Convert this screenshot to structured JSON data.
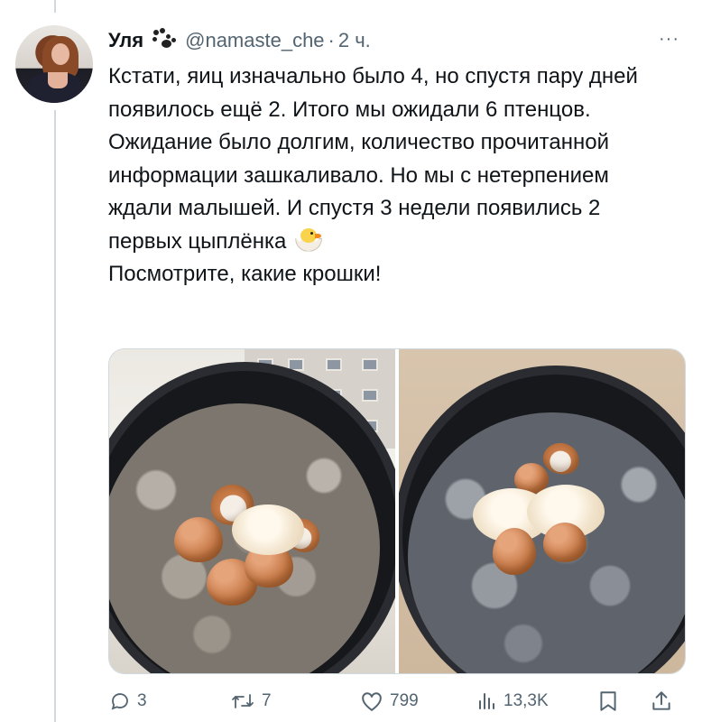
{
  "tweet": {
    "author_name": "Уля",
    "handle": "@namaste_che",
    "separator": "·",
    "time": "2 ч.",
    "more": "···",
    "text": "Кстати, яиц изначально было 4, но спустя пару дней появилось ещё 2. Итого мы ожидали 6 птенцов. Ожидание было долгим, количество прочитанной информации зашкаливало. Но мы с нетерпением ждали малышей. И спустя 3 недели появились 2 первых цыплёнка",
    "text_line2": "Посмотрите, какие крошки!",
    "emoji": "hatching-chick-icon"
  },
  "actions": {
    "replies": "3",
    "reposts": "7",
    "likes": "799",
    "views": "13,3K"
  },
  "colors": {
    "text": "#0f1419",
    "muted": "#536471",
    "border": "#cfd9de"
  }
}
